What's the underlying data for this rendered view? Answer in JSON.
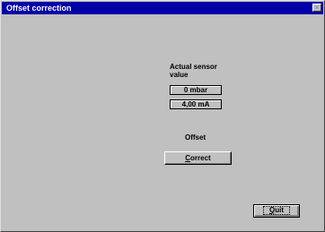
{
  "window": {
    "title": "Offset correction",
    "close_glyph": "×"
  },
  "sensor": {
    "heading": "Actual sensor value",
    "heading_line1": "Actual sensor",
    "heading_line2": "value",
    "pressure_value": "0 mbar",
    "current_value": "4,00 mA"
  },
  "offset": {
    "label": "Offset",
    "correct_button": "Correct",
    "correct_button_mnemonic": "C",
    "correct_button_rest": "orrect"
  },
  "footer": {
    "quit_button": "Quit",
    "quit_button_mnemonic": "Q",
    "quit_button_rest": "uit"
  },
  "icons": {
    "close": "close-icon"
  }
}
